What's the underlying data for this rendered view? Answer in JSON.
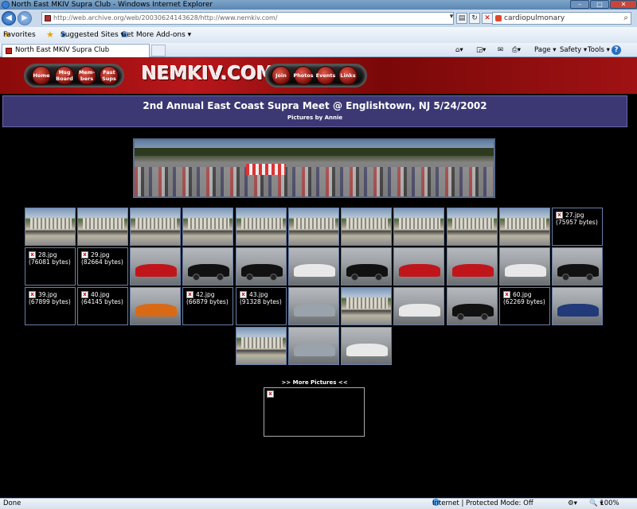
{
  "window": {
    "title": "North East MKIV Supra Club - Windows Internet Explorer",
    "minimize": "–",
    "maximize": "□",
    "close": "✕"
  },
  "address_bar": {
    "url": "http://web.archive.org/web/20030624143628/http://www.nemkiv.com/",
    "search_value": "cardiopulmonary"
  },
  "favorites_bar": {
    "favorites_label": "Favorites",
    "suggested_sites": "Suggested Sites ▾",
    "addons": "Get More Add-ons ▾"
  },
  "tab": {
    "label": "North East MKIV Supra Club"
  },
  "command_bar": {
    "page": "Page ▾",
    "safety": "Safety ▾",
    "tools": "Tools ▾",
    "help": "?"
  },
  "site_nav_left": [
    "Home",
    "Msg Board",
    "Mem-bers",
    "Fast Sups"
  ],
  "site_nav_right": [
    "Join",
    "Photos",
    "Events",
    "Links"
  ],
  "site_logo": "NEMKIV.COM",
  "page": {
    "heading": "2nd Annual East Coast Supra Meet @ Englishtown, NJ 5/24/2002",
    "byline": "Pictures by Annie",
    "more_pictures": ">> More Pictures <<"
  },
  "broken_images": {
    "b27": "27.jpg (75957 bytes)",
    "b28": "28.jpg (76081 bytes)",
    "b29": "29.jpg (82664 bytes)",
    "b39": "39.jpg (67899 bytes)",
    "b40": "40.jpg (64145 bytes)",
    "b42": "42.jpg (66879 bytes)",
    "b43": "43.jpg (91328 bytes)",
    "b60": "60.jpg (62269 bytes)"
  },
  "status_bar": {
    "left": "Done",
    "zone": "Internet | Protected Mode: Off",
    "zoom": "100%"
  }
}
